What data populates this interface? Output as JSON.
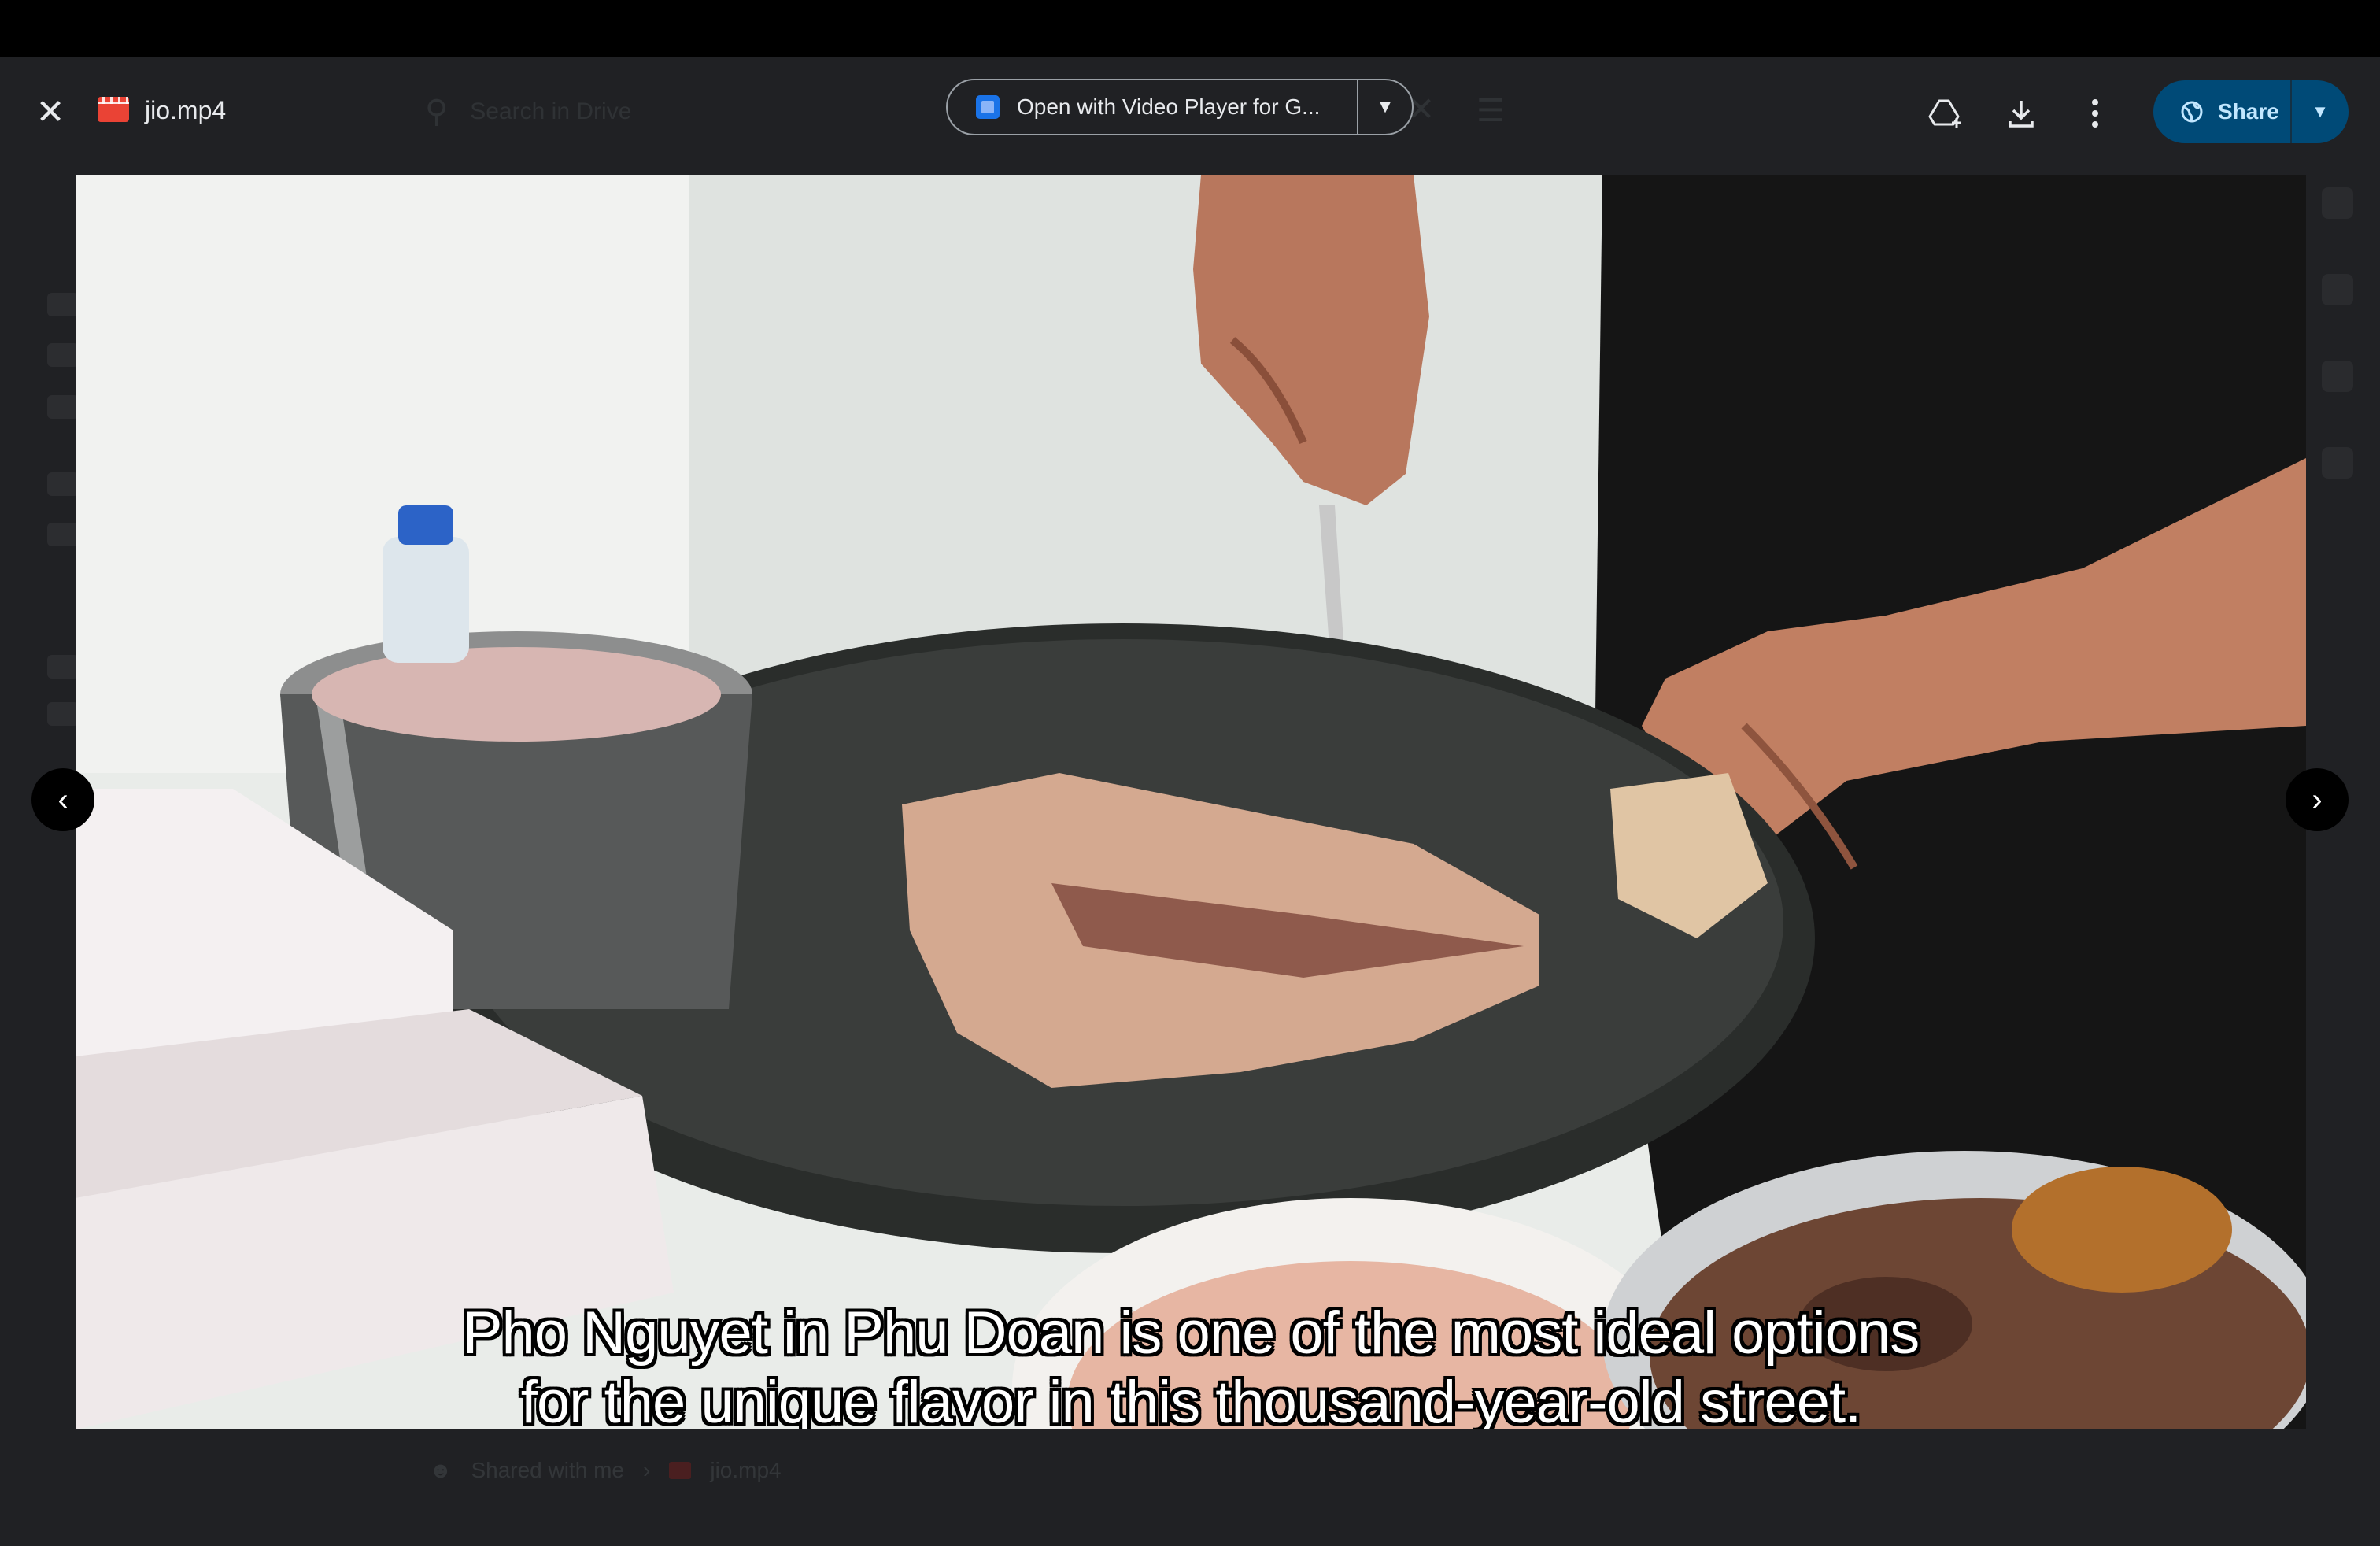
{
  "header": {
    "file_name": "jio.mp4",
    "open_with_label": "Open with Video Player for G...",
    "share_label": "Share"
  },
  "background": {
    "search_placeholder": "Search in Drive",
    "breadcrumb": [
      "Shared with me",
      "jio.mp4"
    ]
  },
  "video": {
    "subtitle_line_1": "Pho Nguyet in Phu Doan is one of the most ideal options",
    "subtitle_line_2": "for the unique flavor in this thousand-year-old street."
  },
  "icons": {
    "close": "close-icon",
    "file_type": "video-file-icon",
    "open_with_app": "video-player-app-icon",
    "add_to_drive": "add-to-drive-icon",
    "download": "download-icon",
    "more": "more-vert-icon",
    "globe": "globe-icon",
    "prev": "chevron-left-icon",
    "next": "chevron-right-icon"
  },
  "colors": {
    "background": "#202124",
    "share_button": "#004a77",
    "share_text": "#c2e7ff",
    "file_icon": "#ea4335"
  }
}
